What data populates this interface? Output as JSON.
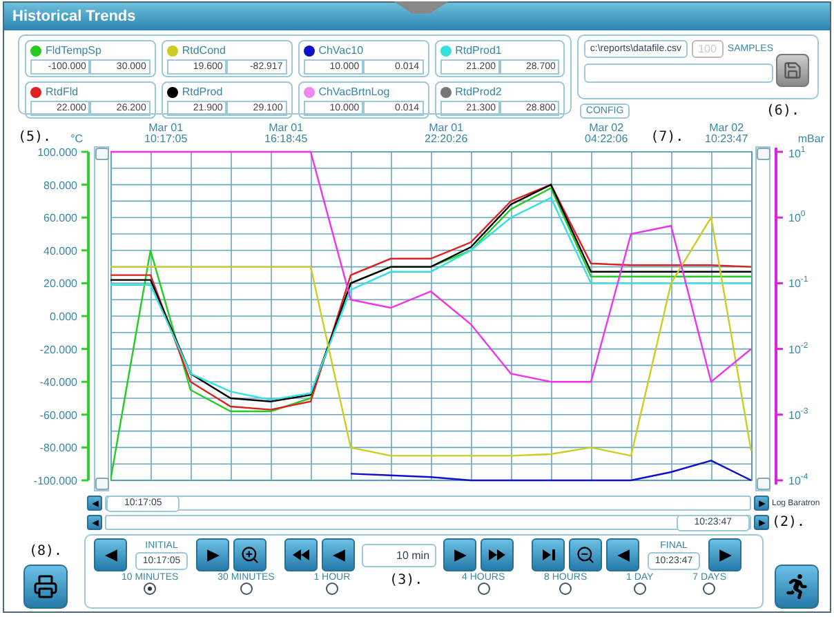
{
  "window": {
    "title": "Historical Trends"
  },
  "channels": [
    {
      "name": "FldTempSp",
      "color": "#22cc22",
      "low": "-100.000",
      "high": "30.000"
    },
    {
      "name": "RtdCond",
      "color": "#cccc22",
      "low": "19.600",
      "high": "-82.917"
    },
    {
      "name": "ChVac10",
      "color": "#1010cc",
      "low": "10.000",
      "high": "0.014"
    },
    {
      "name": "RtdProd1",
      "color": "#33e0e0",
      "low": "21.200",
      "high": "28.700"
    },
    {
      "name": "RtdFld",
      "color": "#dd2020",
      "low": "22.000",
      "high": "26.200"
    },
    {
      "name": "RtdProd",
      "color": "#000000",
      "low": "21.900",
      "high": "29.100"
    },
    {
      "name": "ChVacBrtnLog",
      "color": "#ee88ee",
      "low": "10.000",
      "high": "0.014"
    },
    {
      "name": "RtdProd2",
      "color": "#777777",
      "low": "21.300",
      "high": "28.800"
    }
  ],
  "export": {
    "file_path": "c:\\reports\\datafile.csv",
    "samples": "100",
    "samples_disabled": true,
    "samples_label": "SAMPLES"
  },
  "config_button": "CONFIG",
  "marker_6": "(6).",
  "marker_5": "(5).",
  "marker_7": "(7).",
  "marker_2": "(2).",
  "marker_8": "(8).",
  "marker_3": "(3).",
  "left_unit": "°C",
  "right_unit": "mBar",
  "right_ticks": [
    {
      "base": "10",
      "exponent": "1"
    },
    {
      "base": "10",
      "exponent": "0"
    },
    {
      "base": "10",
      "exponent": "-1"
    },
    {
      "base": "10",
      "exponent": "-2"
    },
    {
      "base": "10",
      "exponent": "-3"
    },
    {
      "base": "10",
      "exponent": "-4"
    }
  ],
  "chart_data": {
    "type": "line",
    "categories": [
      null,
      "Mar 01 10:17:05",
      null,
      null,
      "Mar 01 16:18:45",
      null,
      null,
      null,
      "Mar 01 22:20:26",
      null,
      null,
      null,
      "Mar 02 04:22:06",
      null,
      null,
      "Mar 02 10:23:47",
      null
    ],
    "ylim": [
      -100,
      100
    ],
    "grid": true,
    "yticks": [
      {
        "value": 100,
        "label": "100.000"
      },
      {
        "value": 80,
        "label": "80.000"
      },
      {
        "value": 60,
        "label": "60.000"
      },
      {
        "value": 40,
        "label": "40.000"
      },
      {
        "value": 20,
        "label": "20.000"
      },
      {
        "value": 0,
        "label": "0.000"
      },
      {
        "value": -20,
        "label": "-20.000"
      },
      {
        "value": -40,
        "label": "-40.000"
      },
      {
        "value": -60,
        "label": "-60.000"
      },
      {
        "value": -80,
        "label": "-80.000"
      },
      {
        "value": -100,
        "label": "-100.000"
      }
    ],
    "series": [
      {
        "color": "#22cc22",
        "values": [
          -100,
          40,
          -45,
          -58,
          -58,
          -50,
          20,
          30,
          30,
          40,
          65,
          78,
          24,
          24,
          24,
          24,
          24
        ]
      },
      {
        "color": "#dd2020",
        "values": [
          25,
          25,
          -40,
          -55,
          -57,
          -52,
          25,
          35,
          35,
          45,
          70,
          80,
          32,
          31,
          31,
          31,
          30
        ]
      },
      {
        "color": "#000000",
        "values": [
          22,
          22,
          -35,
          -50,
          -52,
          -48,
          20,
          30,
          30,
          42,
          68,
          80,
          27,
          27,
          27,
          27,
          27
        ]
      },
      {
        "color": "#33e0e0",
        "values": [
          19,
          19,
          -35,
          -46,
          -51,
          -47,
          16,
          27,
          27,
          40,
          60,
          72,
          20,
          20,
          20,
          20,
          20
        ]
      },
      {
        "color": "#cccc22",
        "values": [
          30,
          30,
          30,
          30,
          30,
          30,
          -80,
          -85,
          -85,
          -85,
          -85,
          -84,
          -80,
          -85,
          20,
          60,
          -82
        ]
      },
      {
        "color": "#1010cc",
        "values": [
          null,
          null,
          null,
          null,
          null,
          null,
          -96,
          -97,
          -98,
          -100,
          -100,
          -100,
          -100,
          -100,
          -95,
          -88,
          -100
        ]
      },
      {
        "color": "#ee33ee",
        "values": [
          100,
          100,
          100,
          100,
          100,
          100,
          10,
          5,
          15,
          -5,
          -35,
          -40,
          -40,
          50,
          55,
          -40,
          -20
        ]
      }
    ]
  },
  "right_axis_label": "Log Baratron",
  "scroll": {
    "start": "10:17:05",
    "end": "10:23:47"
  },
  "controls": {
    "initial_label": "INITIAL",
    "initial": "10:17:05",
    "step": "10 min",
    "final_label": "FINAL",
    "final": "10:23:47"
  },
  "ranges": [
    {
      "label": "10 MINUTES",
      "selected": true
    },
    {
      "label": "30 MINUTES",
      "selected": false
    },
    {
      "label": "1 HOUR",
      "selected": false
    },
    {
      "label": "4 HOURS",
      "selected": false
    },
    {
      "label": "8 HOURS",
      "selected": false
    },
    {
      "label": "1 DAY",
      "selected": false
    },
    {
      "label": "7 DAYS",
      "selected": false
    }
  ]
}
